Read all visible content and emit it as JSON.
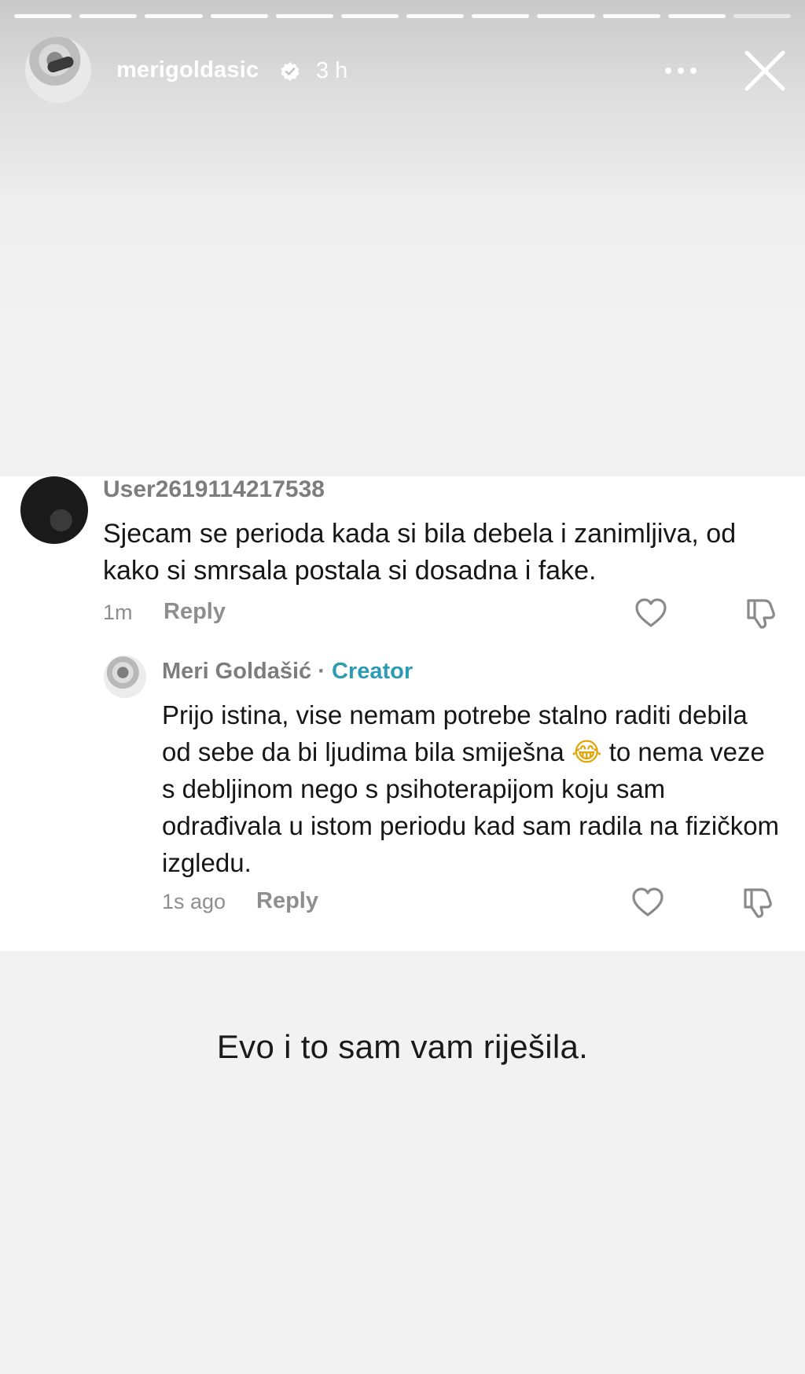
{
  "story": {
    "username": "merigoldasic",
    "time": "3 h",
    "verified_icon": "verified-badge-icon",
    "more_icon": "more-dots-icon",
    "close_icon": "close-icon",
    "progress_segments": 12,
    "caption": "Evo i to sam vam riješila."
  },
  "comment": {
    "user": "User2619114217538",
    "text": "Sjecam se perioda kada si bila debela i zanimljiva, od kako si smrsala postala si dosadna i fake.",
    "time": "1m",
    "reply_label": "Reply"
  },
  "reply": {
    "name": "Meri Goldašić",
    "separator": "·",
    "badge": "Creator",
    "badge_color": "#2b9cb3",
    "text_before_emoji": "Prijo istina, vise nemam potrebe stalno raditi debila od sebe da bi ljudima bila smiješna",
    "emoji": "😂",
    "text_after_emoji": "to nema veze s debljinom nego s psihoterapijom koju sam odrađivala u istom periodu kad sam radila na fizičkom izgledu.",
    "time": "1s ago",
    "reply_label": "Reply"
  }
}
